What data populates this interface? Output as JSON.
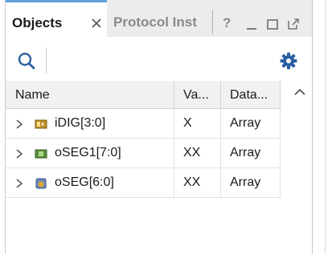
{
  "tabs": {
    "active_label": "Objects",
    "inactive_label": "Protocol Inst",
    "help_label": "?"
  },
  "icons": {
    "close": "close-icon",
    "minimize": "minimize-icon",
    "maximize": "maximize-icon",
    "float": "float-window-icon",
    "search": "search-icon",
    "settings": "gear-icon",
    "expand": "chevron-right-icon",
    "scroll_up": "chevron-up-icon"
  },
  "colors": {
    "accent": "#5f9ed8",
    "toolbar_icon": "#2c5fa0",
    "signal_icon_out": "#5c8f3a",
    "signal_icon_in": "#c0902a"
  },
  "table": {
    "headers": [
      "Name",
      "Va...",
      "Data..."
    ],
    "rows": [
      {
        "name": "iDIG[3:0]",
        "value": "X",
        "type": "Array",
        "icon": "input-array-icon"
      },
      {
        "name": "oSEG1[7:0]",
        "value": "XX",
        "type": "Array",
        "icon": "output-array-icon"
      },
      {
        "name": "oSEG[6:0]",
        "value": "XX",
        "type": "Array",
        "icon": "output-array-icon"
      }
    ]
  }
}
